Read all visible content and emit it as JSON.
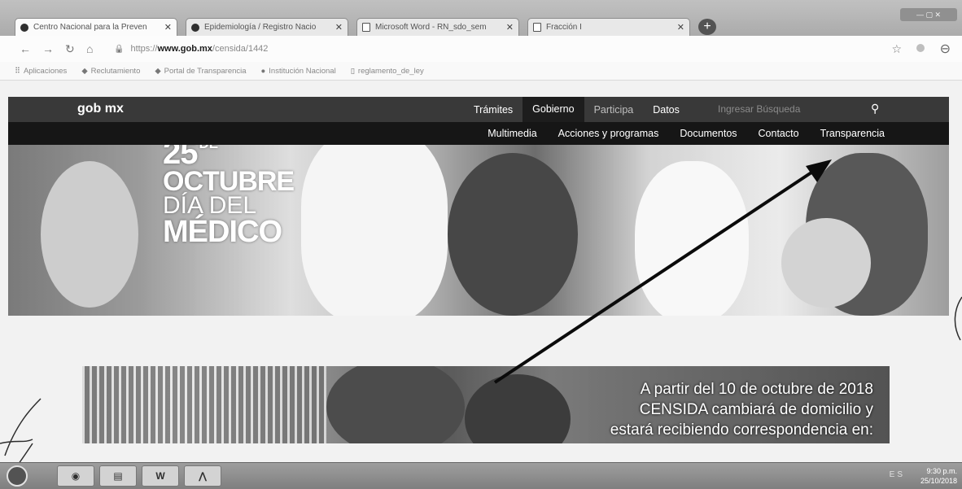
{
  "browser": {
    "tabs": [
      {
        "label": "Centro Nacional para la Preven",
        "icon": "circle-icon",
        "active": true
      },
      {
        "label": "Epidemiología / Registro Nacio",
        "icon": "circle-icon",
        "active": false
      },
      {
        "label": "Microsoft Word - RN_sdo_sem",
        "icon": "document-icon",
        "active": false
      },
      {
        "label": "Fracción I",
        "icon": "document-icon",
        "active": false
      }
    ],
    "new_tab_glyph": "+",
    "url_prefix": "https://",
    "url_domain": "www.gob.mx",
    "url_path": "/censida/1442",
    "bookmarks": [
      {
        "label": "Aplicaciones"
      },
      {
        "label": "Reclutamiento"
      },
      {
        "label": "Portal de Transparencia"
      },
      {
        "label": "Institución Nacional"
      },
      {
        "label": "reglamento_de_ley"
      }
    ]
  },
  "site": {
    "logo": "gob mx",
    "nav": [
      "Trámites",
      "Gobierno",
      "Participa",
      "Datos"
    ],
    "search_placeholder": "Ingresar Búsqueda",
    "subnav": [
      "Multimedia",
      "Acciones y programas",
      "Documentos",
      "Contacto",
      "Transparencia"
    ]
  },
  "hero": {
    "day": "25",
    "de": "DE",
    "month": "OCTUBRE",
    "dia_del": "DÍA DEL",
    "medico": "MÉDICO"
  },
  "banner": {
    "line1": "A partir del 10 de octubre de 2018",
    "line2": "CENSIDA cambiará de domicilio y",
    "line3": "estará recibiendo correspondencia en:"
  },
  "taskbar": {
    "tray": "ES",
    "time": "9:30 p.m.",
    "date": "25/10/2018"
  },
  "colors": {
    "header_bg": "#3c3c3c",
    "subnav_bg": "#1b1b1b"
  }
}
